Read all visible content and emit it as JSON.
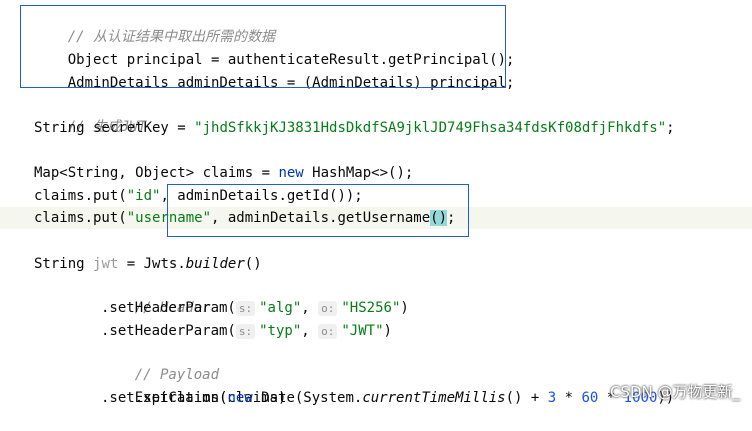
{
  "code": {
    "l1_comment": "// 从认证结果中取出所需的数据",
    "l2": "Object principal = authenticateResult.getPrincipal();",
    "l3": "AdminDetails adminDetails = (AdminDetails) principal;",
    "l5_comment": "// 生成JWT",
    "l6_a": "String secretKey = ",
    "l6_str": "\"jhdSfkkjKJ3831HdsDkdfSA9jklJD749Fhsa34fdsKf08dfjFhkdfs\"",
    "l6_b": ";",
    "l8_a": "Map<String, Object> claims = ",
    "l8_kw": "new",
    "l8_b": " HashMap<>();",
    "l9_a": "claims.put(",
    "l9_str": "\"id\"",
    "l9_b": ", adminDetails.getId());",
    "l10_a": "claims.put(",
    "l10_str": "\"username\"",
    "l10_b": ", adminDetails.getUsername",
    "l10_paren": "()",
    "l10_c": ";",
    "l12_a": "String ",
    "l12_var": "jwt",
    "l12_b": " = Jwts.",
    "l12_method": "builder",
    "l12_c": "()",
    "l13_comment": "// Header",
    "l14_a": ".setHeaderParam(",
    "l14_hint1": "s:",
    "l14_str1": "\"alg\"",
    "l14_sep": ", ",
    "l14_hint2": "o:",
    "l14_str2": "\"HS256\"",
    "l14_b": ")",
    "l15_a": ".setHeaderParam(",
    "l15_hint1": "s:",
    "l15_str1": "\"typ\"",
    "l15_sep": ", ",
    "l15_hint2": "o:",
    "l15_str2": "\"JWT\"",
    "l15_b": ")",
    "l16_comment": "// Payload",
    "l17": ".setClaims(claims)",
    "l18_a": ".setExpiration(",
    "l18_kw": "new",
    "l18_b": " Date(System.",
    "l18_method": "currentTimeMillis",
    "l18_c": "() + ",
    "l18_n1": "3",
    "l18_d": " * ",
    "l18_n2": "60",
    "l18_e": " * ",
    "l18_n3": "1000",
    "l18_f": "))"
  },
  "watermark": "CSDN @万物更新_",
  "colors": {
    "comment": "#8c8c8c",
    "string": "#067d17",
    "keyword": "#0033b3",
    "number": "#1750eb",
    "annotation_box": "#1f5fd6",
    "current_line": "#f5f6ee"
  }
}
